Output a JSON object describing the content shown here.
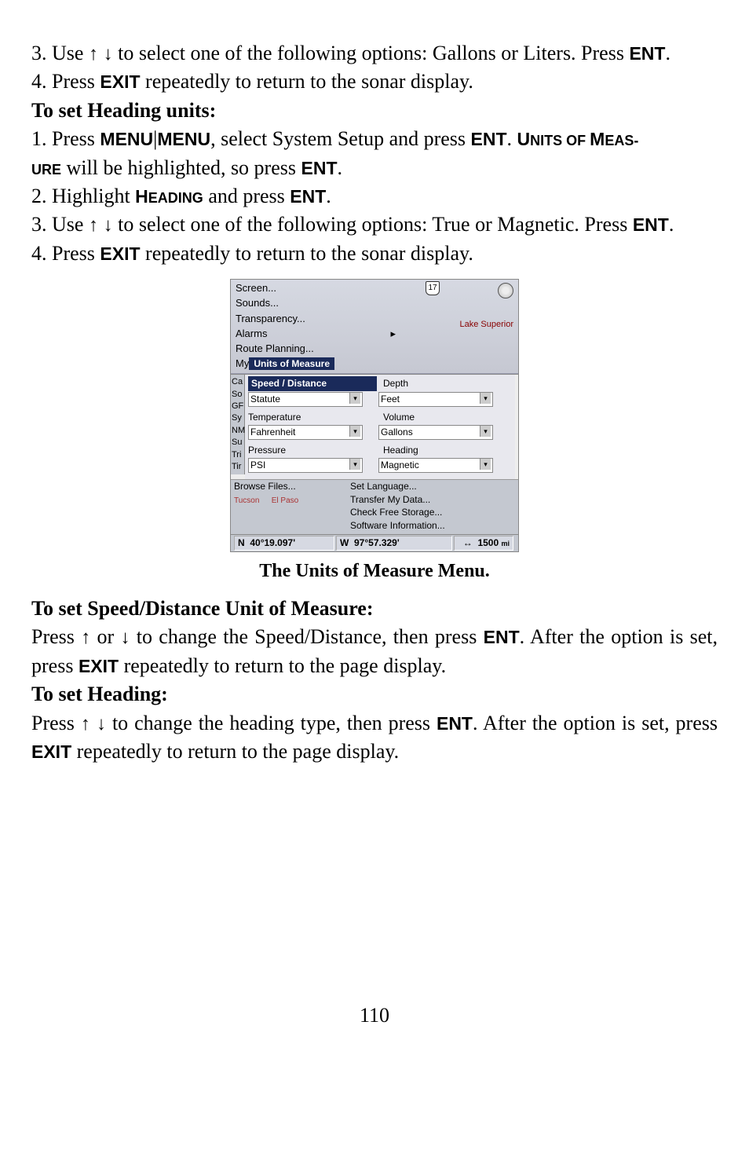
{
  "step3a": {
    "prefix": "3. Use ",
    "arrows": "↑ ↓",
    "mid": " to select one of the following options: Gallons or Liters. Press ",
    "ent": "ENT",
    "suffix": "."
  },
  "step4a": {
    "prefix": "4. Press ",
    "exit": "EXIT",
    "suffix": " repeatedly to return to the sonar display."
  },
  "heading_units_title": "To set Heading units:",
  "step1b": {
    "prefix": "1. Press ",
    "menu": "MENU",
    "sep": "|",
    "menu2": "MENU",
    "mid1": ", select System Setup and press ",
    "ent": "ENT",
    "dot": ". ",
    "uom1": "U",
    "uom2": "NITS OF ",
    "uom3": "M",
    "uom4": "EAS-",
    "line2a": "URE",
    "line2b": " will be highlighted, so press ",
    "ent2": "ENT",
    "dot2": "."
  },
  "step2b": {
    "prefix": "2. Highlight ",
    "h1": "H",
    "h2": "EADING",
    "mid": " and press ",
    "ent": "ENT",
    "dot": "."
  },
  "step3b": {
    "prefix": "3. Use ",
    "arrows": "↑ ↓",
    "mid": " to select one of the following options: True or Magnetic. Press ",
    "ent": "ENT",
    "dot": "."
  },
  "step4b": {
    "prefix": "4. Press ",
    "exit": "EXIT",
    "suffix": " repeatedly to return to the sonar display."
  },
  "figure": {
    "menu_items": {
      "screen": "Screen...",
      "sounds": "Sounds...",
      "transparency": "Transparency...",
      "alarms": "Alarms",
      "route": "Route Planning..."
    },
    "lake": "Lake Superior",
    "hwy": "17",
    "my_prefix": "My",
    "highlight": "Units of Measure",
    "left_bits": {
      "ca": "Ca",
      "so": "So",
      "gf": "GF",
      "sy": "Sy",
      "nm": "NM",
      "su": "Su",
      "tri": "Tri",
      "tir": "Tir"
    },
    "labels": {
      "speed": "Speed / Distance",
      "depth": "Depth",
      "temp": "Temperature",
      "volume": "Volume",
      "pressure": "Pressure",
      "heading": "Heading"
    },
    "values": {
      "statute": "Statute",
      "feet": "Feet",
      "fahrenheit": "Fahrenheit",
      "gallons": "Gallons",
      "psi": "PSI",
      "magnetic": "Magnetic"
    },
    "browse": "Browse Files...",
    "setlang": "Set Language...",
    "transfer": "Transfer My Data...",
    "checkfree": "Check Free Storage...",
    "swinfo": "Software Information...",
    "tucson": "Tucson",
    "elpaso": "El Paso",
    "status": {
      "n": "N",
      "lat": "40°19.097'",
      "w": "W",
      "lon": "97°57.329'",
      "arr": "↔",
      "dist": "1500",
      "mi": "mi"
    }
  },
  "caption": "The Units of Measure Menu.",
  "speed_title": "To set Speed/Distance Unit of Measure:",
  "speed_para": {
    "p1": "Press ",
    "up": "↑",
    "or": " or ",
    "down": "↓",
    "p2": " to change the Speed/Distance, then press ",
    "ent": "ENT",
    "p3": ". After the option is set, press ",
    "exit": "EXIT",
    "p4": " repeatedly to return to the page display."
  },
  "set_heading_title": "To set Heading:",
  "heading_para": {
    "p1": "Press ",
    "arrows": "↑ ↓",
    "p2": " to change the heading type, then press ",
    "ent": "ENT",
    "p3": ". After the option is set, press ",
    "exit": "EXIT",
    "p4": " repeatedly to return to the page display."
  },
  "page": "110"
}
